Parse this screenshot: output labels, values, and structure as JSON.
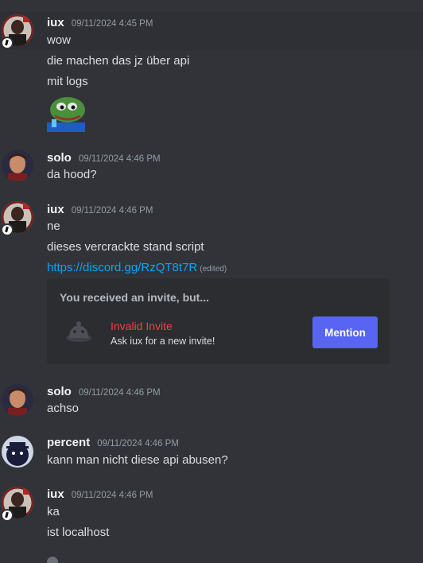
{
  "messages": [
    {
      "username": "iux",
      "timestamp": "09/11/2024 4:45 PM",
      "lines": [
        "wow",
        "die machen das jz über api",
        "mit logs"
      ],
      "sticker": "pepe-frog-sticker"
    },
    {
      "username": "solo",
      "timestamp": "09/11/2024 4:46 PM",
      "lines": [
        "da hood?"
      ]
    },
    {
      "username": "iux",
      "timestamp": "09/11/2024 4:46 PM",
      "lines": [
        "ne",
        "dieses vercrackte stand script"
      ],
      "link": "https://discord.gg/RzQT8t7R",
      "edited": "(edited)"
    },
    {
      "username": "solo",
      "timestamp": "09/11/2024 4:46 PM",
      "lines": [
        "achso"
      ]
    },
    {
      "username": "percent",
      "timestamp": "09/11/2024 4:46 PM",
      "lines": [
        "kann man nicht diese api abusen?"
      ]
    },
    {
      "username": "iux",
      "timestamp": "09/11/2024 4:46 PM",
      "lines": [
        "ka",
        "ist localhost"
      ]
    }
  ],
  "invite": {
    "title": "You received an invite, but...",
    "name": "Invalid Invite",
    "subtitle": "Ask iux for a new invite!",
    "button": "Mention"
  },
  "colors": {
    "background": "#313338",
    "link": "#00a8fc",
    "invalid": "#f23f43",
    "button": "#5865f2"
  }
}
